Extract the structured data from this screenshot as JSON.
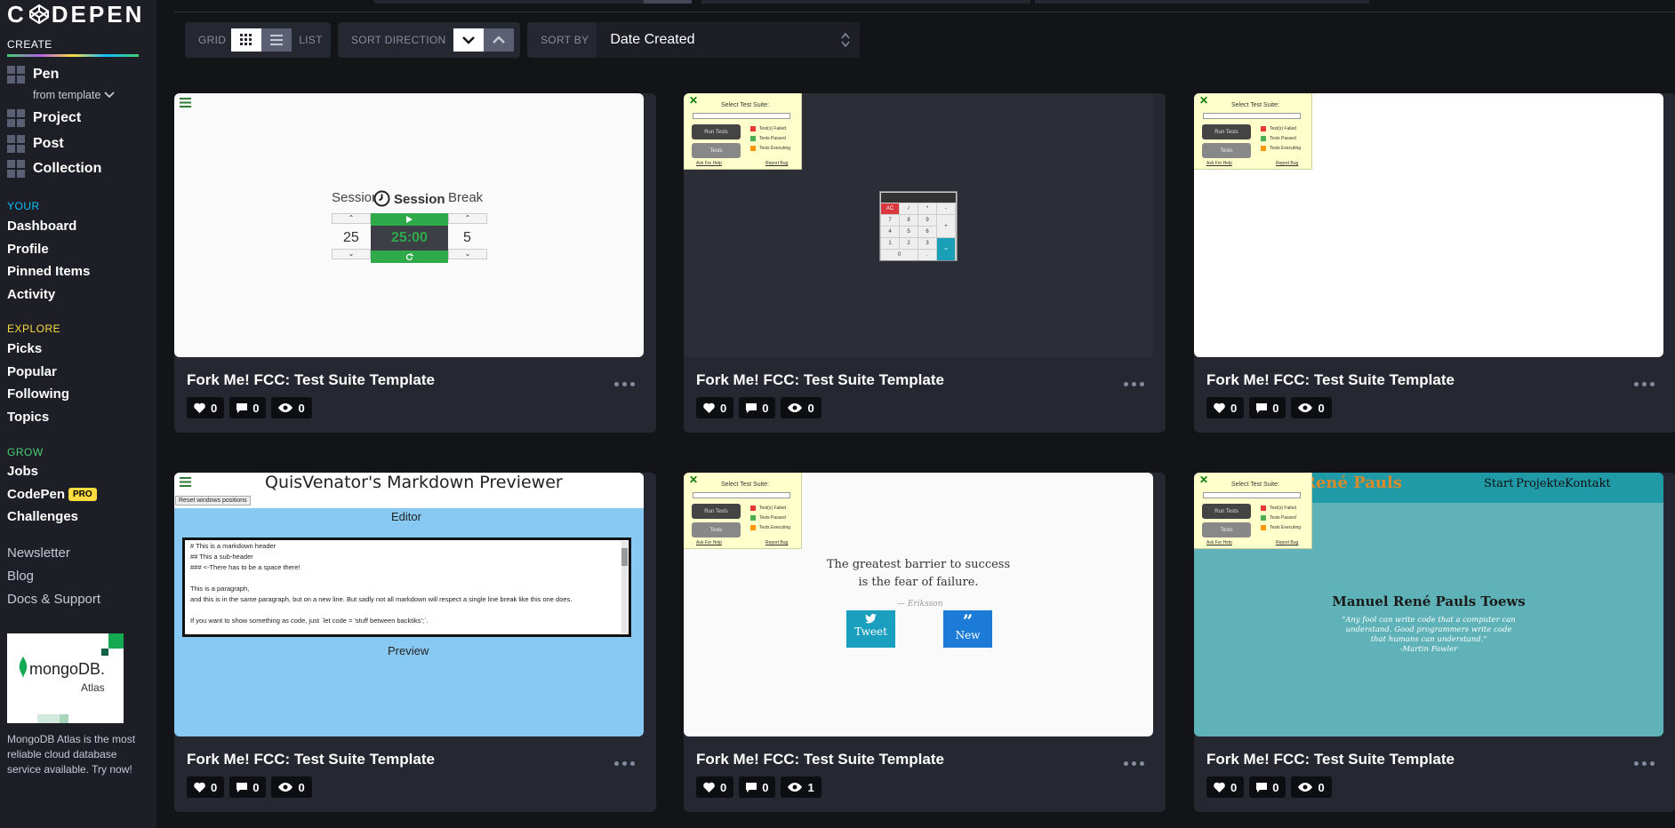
{
  "sidebar": {
    "logo": "CODEPEN",
    "create_title": "CREATE",
    "create_items": {
      "pen": "Pen",
      "from_template": "from template",
      "project": "Project",
      "post": "Post",
      "collection": "Collection"
    },
    "your_title": "YOUR",
    "your_items": [
      "Dashboard",
      "Profile",
      "Pinned Items",
      "Activity"
    ],
    "explore_title": "EXPLORE",
    "explore_items": [
      "Picks",
      "Popular",
      "Following",
      "Topics"
    ],
    "grow_title": "GROW",
    "grow_items": [
      "Jobs",
      "CodePen",
      "Challenges"
    ],
    "pro_badge": "PRO",
    "misc_items": [
      "Newsletter",
      "Blog",
      "Docs & Support"
    ],
    "ad": {
      "brand": "mongoDB.",
      "sub": "Atlas",
      "text": "MongoDB Atlas is the most reliable cloud database service available. Try now!"
    }
  },
  "controls": {
    "view_label_grid": "GRID",
    "view_label_list": "LIST",
    "sort_direction_label": "SORT DIRECTION",
    "sort_by_label": "SORT BY",
    "sort_by_value": "Date Created"
  },
  "colors": {
    "page_bg": "#131417",
    "sidebar_bg": "#1e1f26",
    "card_bg": "#252830",
    "grow": "#47cf73",
    "your": "#0ebeff",
    "explore": "#ffdd40"
  },
  "cards": [
    {
      "title": "Fork Me! FCC: Test Suite Template",
      "likes": "0",
      "comments": "0",
      "views": "0"
    },
    {
      "title": "Fork Me! FCC: Test Suite Template",
      "likes": "0",
      "comments": "0",
      "views": "0"
    },
    {
      "title": "Fork Me! FCC: Test Suite Template",
      "likes": "0",
      "comments": "0",
      "views": "0"
    },
    {
      "title": "Fork Me! FCC: Test Suite Template",
      "likes": "0",
      "comments": "0",
      "views": "0"
    },
    {
      "title": "Fork Me! FCC: Test Suite Template",
      "likes": "0",
      "comments": "0",
      "views": "1"
    },
    {
      "title": "Fork Me! FCC: Test Suite Template",
      "likes": "0",
      "comments": "0",
      "views": "0"
    }
  ],
  "previews": {
    "pomodoro": {
      "session_label": "Session",
      "session_title": "Session",
      "break_label": "Break",
      "session_len": "25",
      "time": "25:00",
      "break_len": "5"
    },
    "test_suite": {
      "select": "Select Test Suite:",
      "run": "Run Tests",
      "tests": "Tests",
      "failed": "Test(s) Failed",
      "passed": "Tests Passed",
      "executing": "Tests Executing",
      "help": "Ask For Help",
      "bug": "Report Bug"
    },
    "calculator": {
      "keys": [
        "AC",
        "/",
        "*",
        "-",
        "7",
        "8",
        "9",
        "+",
        "4",
        "5",
        "6",
        "1",
        "2",
        "3",
        "=",
        "0",
        "."
      ]
    },
    "markdown": {
      "title": "QuisVenator's Markdown Previewer",
      "reset": "Reset windows positions",
      "editor": "Editor",
      "preview": "Preview",
      "lines": [
        "# This is a markdown header",
        "## This a sub-header",
        "### <-There has to be a space there!",
        "",
        "This is a paragraph,",
        "and this is in the same paragraph, but on a new line. But sadly not all markdown will respect a single line break like this one does.",
        "",
        "If you want to show something as code, just `let code = 'stuff between backtiks';`."
      ]
    },
    "quote": {
      "quote_line1": "The greatest barrier to success",
      "quote_line2": "is the fear of failure.",
      "author": "— Eriksson",
      "tweet": "Tweet",
      "new": "New"
    },
    "portfolio": {
      "brand": "René Pauls",
      "nav": [
        "Start",
        "Projekte",
        "Kontakt"
      ],
      "name": "Manuel René Pauls Toews",
      "quote": "\"Any fool can write code that a computer can understand. Good programmers write code that humans can understand.\"",
      "quote_author": "-Martin Fowler"
    }
  }
}
